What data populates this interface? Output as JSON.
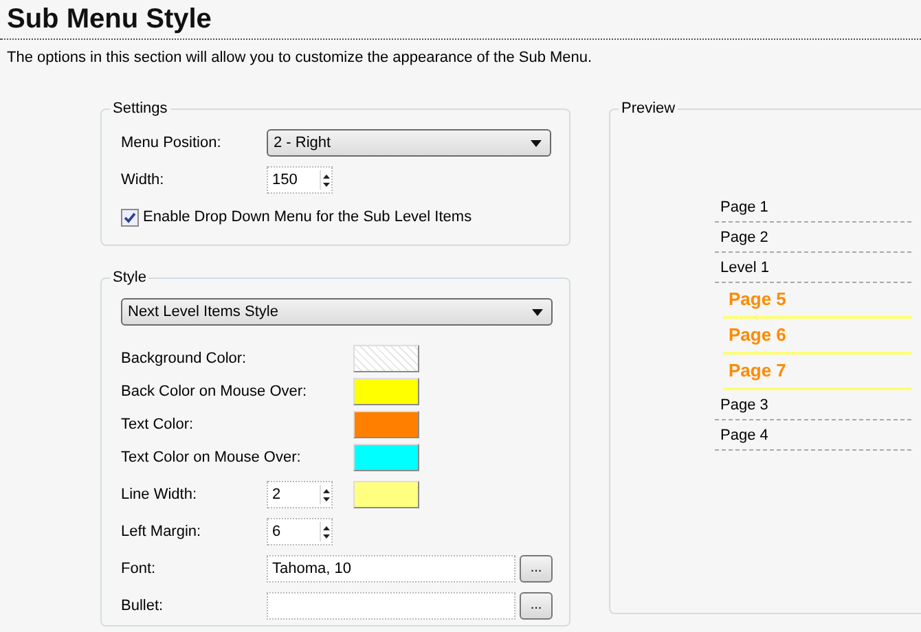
{
  "page": {
    "title": "Sub Menu Style",
    "description": "The options in this section will allow you to customize the appearance of the Sub Menu."
  },
  "settings": {
    "legend": "Settings",
    "fields": [
      {
        "kind": "select",
        "label": "Menu Position:",
        "value": "2 - Right"
      },
      {
        "kind": "spin",
        "label": "Width:",
        "value": "150"
      },
      {
        "kind": "check",
        "label": "Enable Drop Down Menu for the Sub Level Items",
        "checked": true
      }
    ]
  },
  "style": {
    "legend": "Style",
    "selector": "Next Level Items Style",
    "rows": [
      {
        "kind": "color",
        "label": "Background Color:"
      },
      {
        "kind": "color",
        "label": "Back Color on Mouse Over:",
        "color": "#ffff00"
      },
      {
        "kind": "color",
        "label": "Text Color:",
        "color": "#ff8000"
      },
      {
        "kind": "color",
        "label": "Text Color on Mouse Over:",
        "color": "#00ffff"
      },
      {
        "kind": "spin-color",
        "label": "Line Width:",
        "value": "2",
        "color": "#ffff80"
      },
      {
        "kind": "spin",
        "label": "Left Margin:",
        "value": "6"
      },
      {
        "kind": "picker",
        "label": "Font:",
        "value": "Tahoma, 10",
        "button": "..."
      },
      {
        "kind": "picker",
        "label": "Bullet:",
        "button": "..."
      }
    ]
  },
  "preview": {
    "legend": "Preview",
    "items": [
      {
        "label": "Page 1"
      },
      {
        "label": "Page 2"
      },
      {
        "label": "Level 1",
        "children": [
          {
            "label": "Page 5"
          },
          {
            "label": "Page 6"
          },
          {
            "label": "Page 7"
          }
        ]
      },
      {
        "label": "Page 3"
      },
      {
        "label": "Page 4"
      }
    ]
  }
}
